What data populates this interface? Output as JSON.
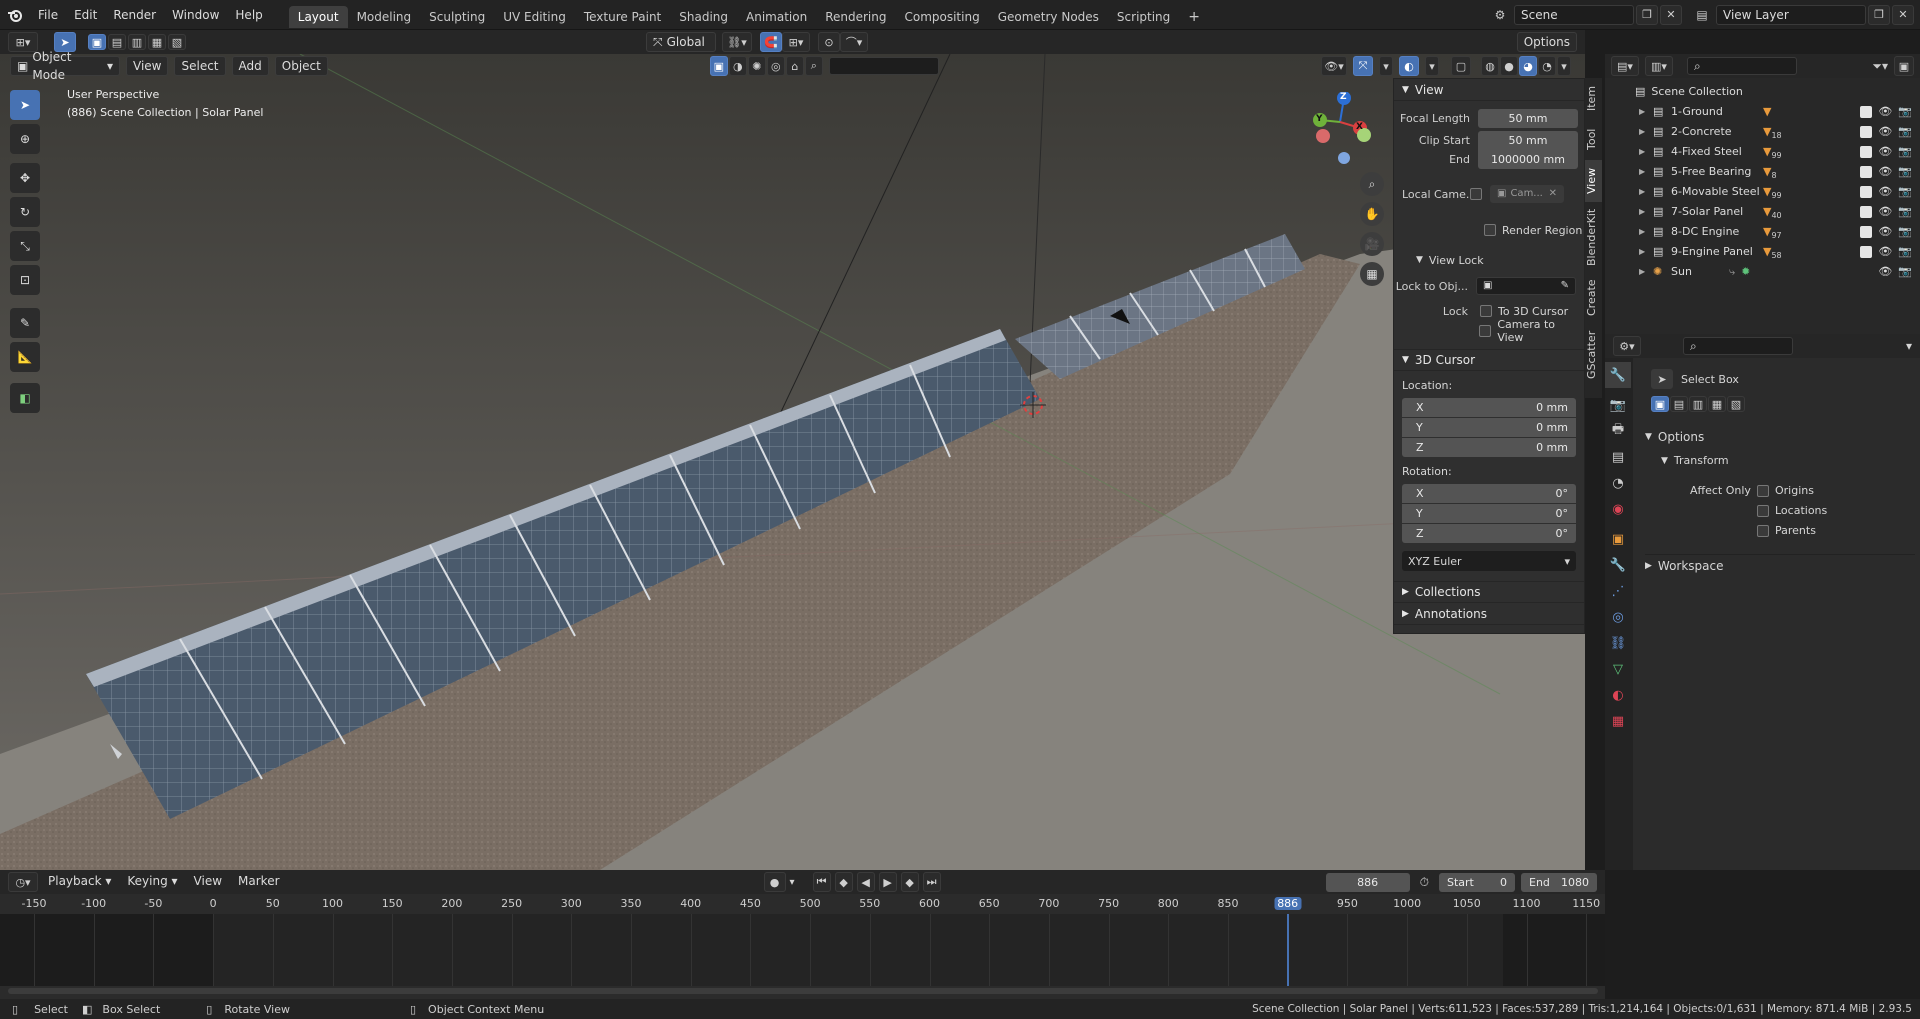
{
  "topbar": {
    "menus": [
      "File",
      "Edit",
      "Render",
      "Window",
      "Help"
    ],
    "workspaces": [
      "Layout",
      "Modeling",
      "Sculpting",
      "UV Editing",
      "Texture Paint",
      "Shading",
      "Animation",
      "Rendering",
      "Compositing",
      "Geometry Nodes",
      "Scripting"
    ],
    "active_workspace": "Layout",
    "add_tab": "+",
    "scene": "Scene",
    "view_layer": "View Layer"
  },
  "toolheader": {
    "transform_orientation": "Global",
    "options": "Options"
  },
  "viewport_header": {
    "mode": "Object Mode",
    "menus": [
      "View",
      "Select",
      "Add",
      "Object"
    ]
  },
  "viewport": {
    "perspective": "User Perspective",
    "context": "(886) Scene Collection | Solar Panel",
    "gizmo": {
      "z": "Z",
      "y": "Y",
      "x": "X"
    }
  },
  "npanel": {
    "view": {
      "title": "View",
      "focal_label": "Focal Length",
      "focal": "50 mm",
      "clip_start_label": "Clip Start",
      "clip_start": "50 mm",
      "end_label": "End",
      "end": "1000000 mm",
      "local_camera_label": "Local Came...",
      "local_camera_value": "Cam...",
      "render_region": "Render Region"
    },
    "view_lock": {
      "title": "View Lock",
      "lock_to_obj": "Lock to Obj...",
      "lock_label": "Lock",
      "to_cursor": "To 3D Cursor",
      "camera_to_view": "Camera to View"
    },
    "cursor": {
      "title": "3D Cursor",
      "location_label": "Location:",
      "loc": [
        {
          "axis": "X",
          "value": "0 mm"
        },
        {
          "axis": "Y",
          "value": "0 mm"
        },
        {
          "axis": "Z",
          "value": "0 mm"
        }
      ],
      "rotation_label": "Rotation:",
      "rot": [
        {
          "axis": "X",
          "value": "0°"
        },
        {
          "axis": "Y",
          "value": "0°"
        },
        {
          "axis": "Z",
          "value": "0°"
        }
      ],
      "mode": "XYZ Euler"
    },
    "collections": "Collections",
    "annotations": "Annotations"
  },
  "sidetabs": [
    "Item",
    "Tool",
    "View",
    "BlenderKit",
    "Create",
    "GScatter"
  ],
  "active_sidetab": "View",
  "outliner": {
    "root": "Scene Collection",
    "items": [
      {
        "name": "1-Ground",
        "badge": ""
      },
      {
        "name": "2-Concrete",
        "badge": "18"
      },
      {
        "name": "4-Fixed Steel",
        "badge": "99"
      },
      {
        "name": "5-Free Bearing",
        "badge": "8"
      },
      {
        "name": "6-Movable Steel",
        "badge": "99"
      },
      {
        "name": "7-Solar Panel",
        "badge": "40"
      },
      {
        "name": "8-DC Engine",
        "badge": "97"
      },
      {
        "name": "9-Engine Panel",
        "badge": "58"
      },
      {
        "name": "Sun",
        "badge": ""
      }
    ]
  },
  "properties": {
    "tool": "Select Box",
    "options": "Options",
    "transform": "Transform",
    "affect_only": "Affect Only",
    "origins": "Origins",
    "locations": "Locations",
    "parents": "Parents",
    "workspace": "Workspace"
  },
  "timeline": {
    "menus": [
      "Playback",
      "Keying",
      "View",
      "Marker"
    ],
    "current_frame": "886",
    "start_label": "Start",
    "start": "0",
    "end_label": "End",
    "end": "1080",
    "ticks": [
      "-150",
      "-100",
      "-50",
      "0",
      "50",
      "100",
      "150",
      "200",
      "250",
      "300",
      "350",
      "400",
      "450",
      "500",
      "550",
      "600",
      "650",
      "700",
      "750",
      "800",
      "850",
      "886",
      "950",
      "1000",
      "1050",
      "1100",
      "1150"
    ],
    "playhead": "886"
  },
  "statusbar": {
    "select": "Select",
    "box_select": "Box Select",
    "rotate_view": "Rotate View",
    "context_menu": "Object Context Menu",
    "stats": "Scene Collection | Solar Panel | Verts:611,523 | Faces:537,289 | Tris:1,214,164 | Objects:0/1,631 | Memory: 871.4 MiB | 2.93.5"
  },
  "colors": {
    "accent": "#4772b3",
    "playhead": "#4772b3",
    "panel": "#2f2f2f"
  }
}
